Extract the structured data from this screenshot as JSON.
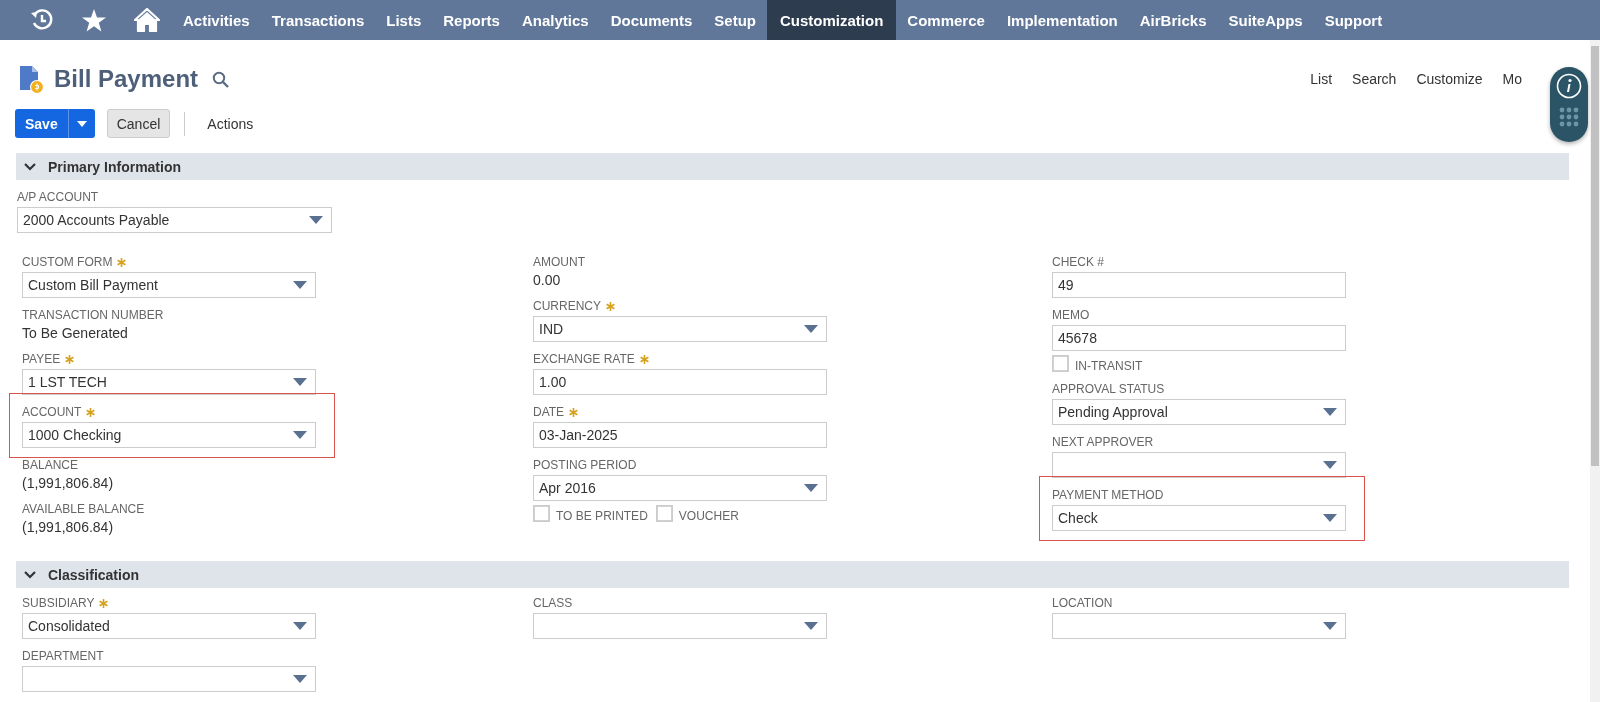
{
  "nav": {
    "items": [
      {
        "label": "Activities",
        "selected": false
      },
      {
        "label": "Transactions",
        "selected": false
      },
      {
        "label": "Lists",
        "selected": false
      },
      {
        "label": "Reports",
        "selected": false
      },
      {
        "label": "Analytics",
        "selected": false
      },
      {
        "label": "Documents",
        "selected": false
      },
      {
        "label": "Setup",
        "selected": false
      },
      {
        "label": "Customization",
        "selected": true
      },
      {
        "label": "Commerce",
        "selected": false
      },
      {
        "label": "Implementation",
        "selected": false
      },
      {
        "label": "AirBricks",
        "selected": false
      },
      {
        "label": "SuiteApps",
        "selected": false
      },
      {
        "label": "Support",
        "selected": false
      }
    ]
  },
  "page": {
    "title": "Bill Payment",
    "header_links": [
      "List",
      "Search",
      "Customize",
      "Mo"
    ]
  },
  "toolbar": {
    "save": "Save",
    "cancel": "Cancel",
    "actions": "Actions"
  },
  "sections": [
    {
      "title": "Primary Information",
      "expanded": true,
      "top_fields": [
        {
          "kind": "select",
          "label": "A/P ACCOUNT",
          "value": "2000 Accounts Payable",
          "required": false,
          "highlighted": false
        }
      ],
      "columns": [
        [
          {
            "kind": "select",
            "label": "CUSTOM FORM",
            "value": "Custom Bill Payment",
            "required": true,
            "highlighted": false
          },
          {
            "kind": "display",
            "label": "TRANSACTION NUMBER",
            "value": "To Be Generated",
            "required": false,
            "highlighted": false
          },
          {
            "kind": "select",
            "label": "PAYEE",
            "value": "1 LST TECH",
            "required": true,
            "highlighted": false
          },
          {
            "kind": "select",
            "label": "ACCOUNT",
            "value": "1000 Checking",
            "required": true,
            "highlighted": true
          },
          {
            "kind": "display",
            "label": "BALANCE",
            "value": "(1,991,806.84)",
            "required": false,
            "highlighted": false
          },
          {
            "kind": "display",
            "label": "AVAILABLE BALANCE",
            "value": "(1,991,806.84)",
            "required": false,
            "highlighted": false
          }
        ],
        [
          {
            "kind": "display",
            "label": "AMOUNT",
            "value": "0.00",
            "required": false,
            "highlighted": false
          },
          {
            "kind": "select",
            "label": "CURRENCY",
            "value": "IND",
            "required": true,
            "highlighted": false
          },
          {
            "kind": "text",
            "label": "EXCHANGE RATE",
            "value": "1.00",
            "required": true,
            "highlighted": false
          },
          {
            "kind": "text",
            "label": "DATE",
            "value": "03-Jan-2025",
            "required": true,
            "highlighted": false
          },
          {
            "kind": "select",
            "label": "POSTING PERIOD",
            "value": "Apr 2016",
            "required": false,
            "highlighted": false
          },
          {
            "kind": "checkboxes",
            "items": [
              {
                "label": "TO BE PRINTED",
                "checked": false
              },
              {
                "label": "VOUCHER",
                "checked": false
              }
            ]
          }
        ],
        [
          {
            "kind": "text",
            "label": "CHECK #",
            "value": "49",
            "required": false,
            "highlighted": false
          },
          {
            "kind": "text",
            "label": "MEMO",
            "value": "45678",
            "required": false,
            "highlighted": false
          },
          {
            "kind": "checkboxes",
            "items": [
              {
                "label": "IN-TRANSIT",
                "checked": false
              }
            ]
          },
          {
            "kind": "select",
            "label": "APPROVAL STATUS",
            "value": "Pending Approval",
            "required": false,
            "highlighted": false
          },
          {
            "kind": "select",
            "label": "NEXT APPROVER",
            "required": false,
            "highlighted": false
          },
          {
            "kind": "select",
            "label": "PAYMENT METHOD",
            "value": "Check",
            "required": false,
            "highlighted": true
          }
        ]
      ]
    },
    {
      "title": "Classification",
      "expanded": true,
      "columns": [
        [
          {
            "kind": "select",
            "label": "SUBSIDIARY",
            "value": "Consolidated",
            "required": true,
            "highlighted": false
          },
          {
            "kind": "select",
            "label": "DEPARTMENT",
            "required": false,
            "highlighted": false
          }
        ],
        [
          {
            "kind": "select",
            "label": "CLASS",
            "required": false,
            "highlighted": false
          }
        ],
        [
          {
            "kind": "select",
            "label": "LOCATION",
            "required": false,
            "highlighted": false
          }
        ]
      ]
    }
  ]
}
